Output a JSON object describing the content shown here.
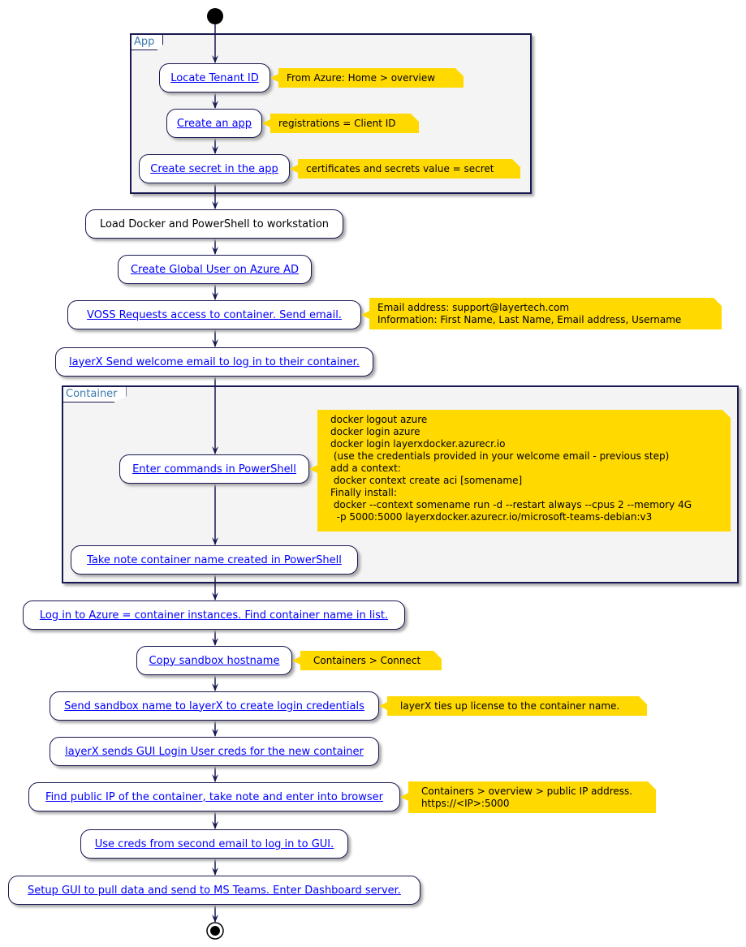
{
  "colors": {
    "line": "#181852",
    "link": "#0000ff",
    "note": "#ffd900",
    "frame_bg": "#f4f4f4",
    "frame_label": "#3a7ab0"
  },
  "frames": {
    "app": "App",
    "container": "Container"
  },
  "activities": {
    "locate_tenant": "Locate Tenant ID",
    "create_app": "Create an app",
    "create_secret": "Create secret in the app",
    "load_docker": "Load Docker and PowerShell to workstation",
    "create_global_user": "Create Global User on Azure AD",
    "voss_requests": "VOSS Requests access to container.  Send email.",
    "layerx_welcome": "layerX Send welcome email to log in to their container.",
    "enter_commands": "Enter commands in PowerShell",
    "take_note": "Take note container name created in PowerShell",
    "login_azure": "Log in to Azure = container instances. Find container name in list.",
    "copy_hostname": "Copy sandbox hostname",
    "send_sandbox": "Send sandbox name to layerX to create login credentials",
    "layerx_sends_gui": "layerX sends GUI Login User creds for the new container",
    "find_ip": "Find public IP of the container, take note and enter into browser",
    "use_creds": "Use creds from second email to log in to GUI.",
    "setup_gui": "Setup GUI to pull data and send to MS Teams. Enter Dashboard server."
  },
  "notes": {
    "locate_tenant": "From Azure: Home > overview",
    "create_app": "registrations = Client ID",
    "create_secret": "certificates and secrets value = secret",
    "voss_requests": "Email address: support@layertech.com\nInformation: First Name, Last Name, Email address, Username",
    "enter_commands": "docker logout azure\ndocker login azure\ndocker login layerxdocker.azurecr.io\n (use the credentials provided in your welcome email - previous step)\nadd a context:\n docker context create aci [somename]\nFinally install:\n docker --context somename run -d --restart always --cpus 2 --memory 4G\n  -p 5000:5000 layerxdocker.azurecr.io/microsoft-teams-debian:v3",
    "copy_hostname": "Containers > Connect",
    "send_sandbox": "layerX ties up license to the container name.",
    "find_ip": "Containers > overview > public IP address.\nhttps://<IP>:5000"
  }
}
